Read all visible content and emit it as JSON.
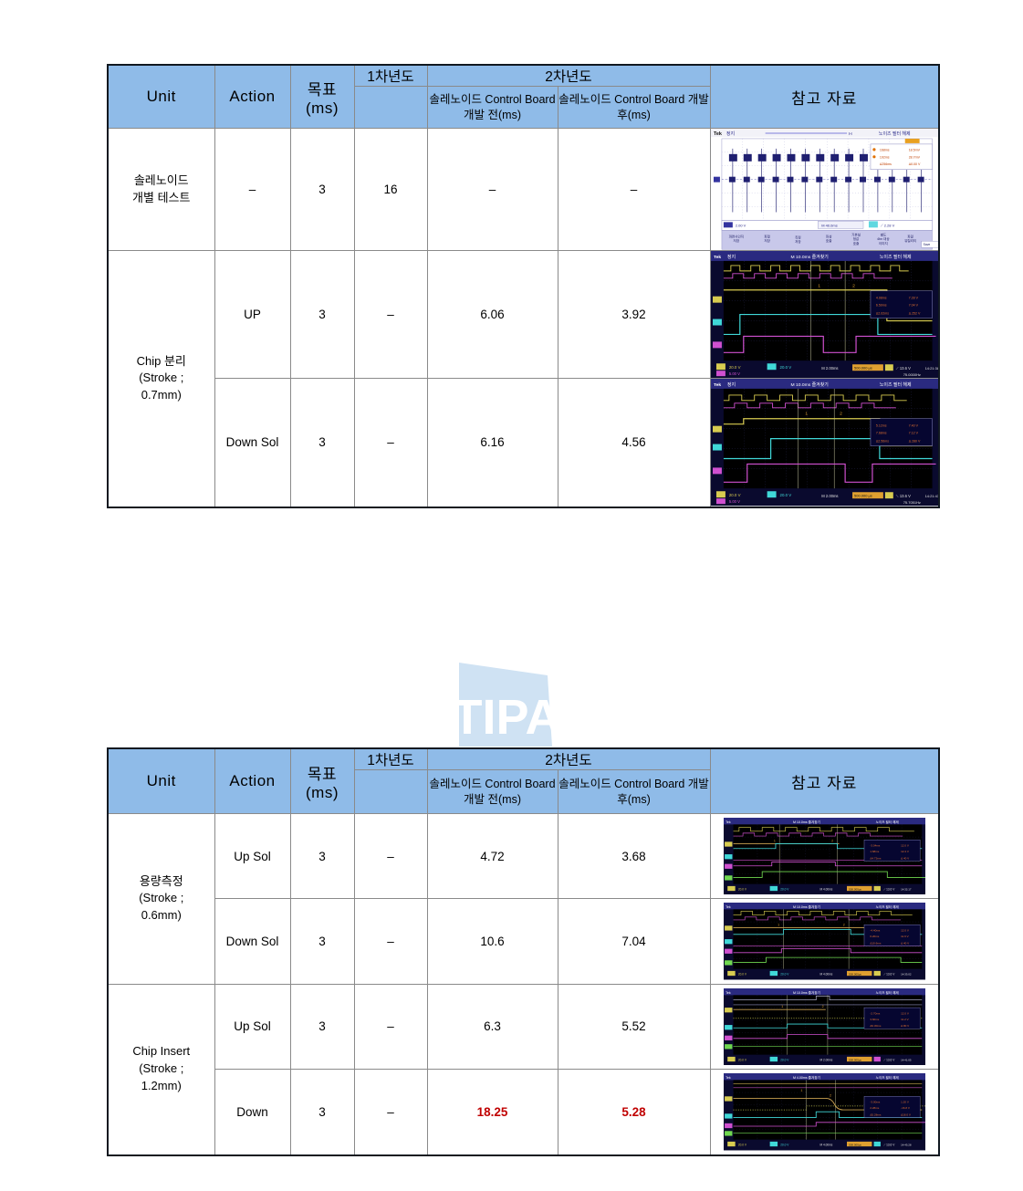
{
  "watermark": {
    "text": "TIPA",
    "shape_color": "#cfe2f3",
    "text_color": "#ffffff"
  },
  "tables": [
    {
      "id": "table1",
      "headers": {
        "unit": "Unit",
        "action": "Action",
        "goal": "목표\n(ms)",
        "goal_line1": "목표",
        "goal_line2": "(ms)",
        "year1": "1차년도",
        "year2": "2차년도",
        "year2_before": "솔레노이드 Control Board 개발 전(ms)",
        "year2_after": "솔레노이드 Control Board 개발 후(ms)",
        "reference": "참고 자료"
      },
      "rows": [
        {
          "unit": "솔레노이드 개별 테스트",
          "unit_line1": "솔레노이드",
          "unit_line2": "개별 테스트",
          "action": "–",
          "goal": "3",
          "year1": "16",
          "year2_before": "–",
          "year2_after": "–",
          "scope": "tek-white"
        },
        {
          "unit": "Chip 분리 (Stroke ; 0.7mm)",
          "unit_line1": "Chip  분리",
          "unit_line2": "(Stroke ;",
          "unit_line3": "0.7mm)",
          "action": "UP",
          "goal": "3",
          "year1": "–",
          "year2_before": "6.06",
          "year2_after": "3.92",
          "scope": "dark-a"
        },
        {
          "unit": "",
          "action": "Down Sol",
          "goal": "3",
          "year1": "–",
          "year2_before": "6.16",
          "year2_after": "4.56",
          "scope": "dark-b"
        }
      ]
    },
    {
      "id": "table2",
      "headers": {
        "unit": "Unit",
        "action": "Action",
        "goal_line1": "목표",
        "goal_line2": "(ms)",
        "year1": "1차년도",
        "year2": "2차년도",
        "year2_before": "솔레노이드 Control Board 개발 전(ms)",
        "year2_after": "솔레노이드 Control Board 개발 후(ms)",
        "reference": "참고 자료"
      },
      "rows": [
        {
          "unit_line1": "용량측정",
          "unit_line2": "(Stroke ;",
          "unit_line3": "0.6mm)",
          "action": "Up Sol",
          "goal": "3",
          "year1": "–",
          "year2_before": "4.72",
          "year2_after": "3.68",
          "scope": "dark-c"
        },
        {
          "action": "Down Sol",
          "goal": "3",
          "year1": "–",
          "year2_before": "10.6",
          "year2_after": "7.04",
          "scope": "dark-d"
        },
        {
          "unit_line1": "Chip  Insert",
          "unit_line2": "(Stroke ;",
          "unit_line3": "1.2mm)",
          "action": "Up Sol",
          "goal": "3",
          "year1": "–",
          "year2_before": "6.3",
          "year2_after": "5.52",
          "scope": "dark-e"
        },
        {
          "action": "Down",
          "goal": "3",
          "year1": "–",
          "year2_before": "18.25",
          "year2_after": "5.28",
          "highlight": "#c00000",
          "scope": "dark-f"
        }
      ]
    }
  ],
  "colors": {
    "header_blue": "#8fbbe8",
    "border_dark": "#101820",
    "grid_gray": "#8a8a8a",
    "red_value": "#c00000",
    "scope_trace_yellow": "#d4c84a",
    "scope_trace_cyan": "#3fd8d8",
    "scope_trace_magenta": "#d84ad8",
    "scope_trace_green": "#4ad84a",
    "scope_bg": "#000000",
    "scope_chrome": "#1b1b5e"
  }
}
